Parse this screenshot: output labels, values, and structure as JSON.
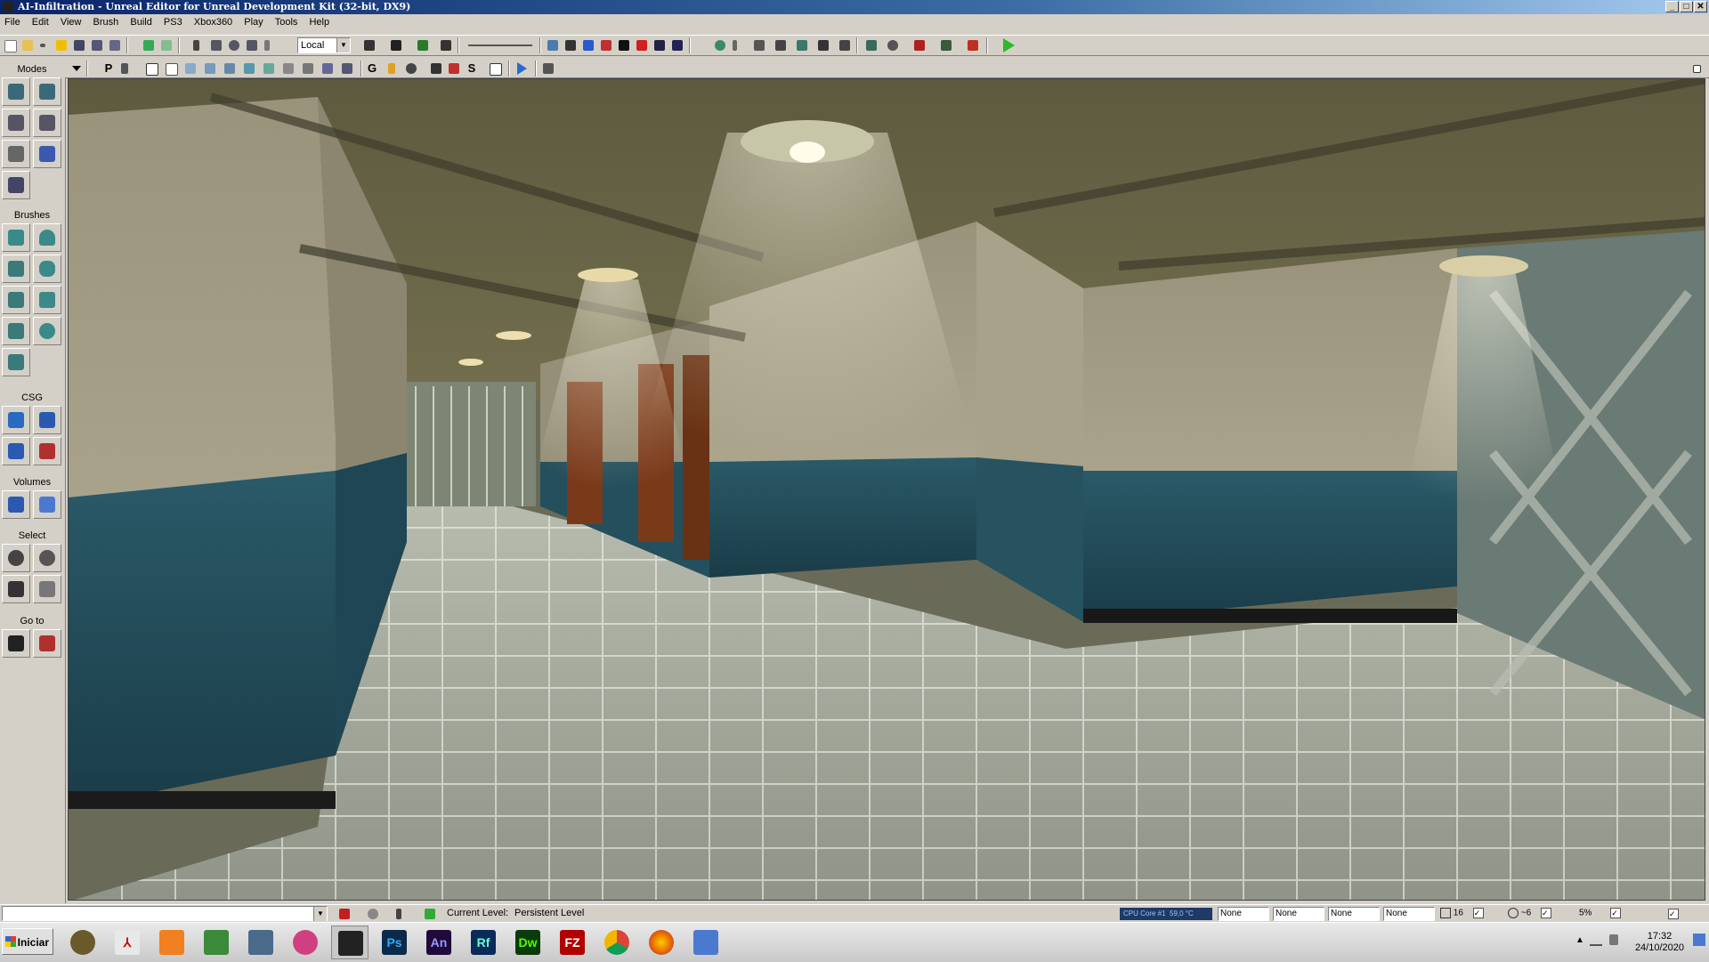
{
  "window": {
    "title": "AI-Infiltration - Unreal Editor for Unreal Development Kit (32-bit, DX9)",
    "controls": {
      "minimize": "_",
      "maximize": "□",
      "close": "✕"
    }
  },
  "menu": [
    "File",
    "Edit",
    "View",
    "Brush",
    "Build",
    "PS3",
    "Xbox360",
    "Play",
    "Tools",
    "Help"
  ],
  "toolbar": {
    "coord_system": "Local"
  },
  "left_panel": {
    "sections": {
      "modes": "Modes",
      "brushes": "Brushes",
      "csg": "CSG",
      "volumes": "Volumes",
      "select": "Select",
      "goto": "Go to"
    }
  },
  "viewport_toolbar": {
    "letters": {
      "p": "P",
      "g": "G",
      "s": "S"
    }
  },
  "status": {
    "current_level_label": "Current Level:",
    "current_level_value": "Persistent Level",
    "cpu_label": "CPU Core #1",
    "cpu_temp": "59,0 °C",
    "fields": [
      "None",
      "None",
      "None",
      "None"
    ],
    "grid_snap": "16",
    "rotation_snap": "~6",
    "scale_snap": "5%"
  },
  "taskbar": {
    "start_label": "Iniciar",
    "apps": [
      {
        "name": "ps",
        "label": "Ps",
        "color": "#0b2a4a",
        "fg": "#31a8ff"
      },
      {
        "name": "an",
        "label": "An",
        "color": "#1f0a3a",
        "fg": "#9999ff"
      },
      {
        "name": "rf",
        "label": "Rf",
        "color": "#0a2a5a",
        "fg": "#6fc"
      },
      {
        "name": "dw",
        "label": "Dw",
        "color": "#0b3a0b",
        "fg": "#4cff00"
      },
      {
        "name": "fz",
        "label": "FZ",
        "color": "#b00000",
        "fg": "#fff"
      }
    ],
    "clock_time": "17:32",
    "clock_date": "24/10/2020"
  },
  "colors": {
    "title_bar": "#0a246a",
    "chrome": "#d4d0c8",
    "wall_blue": "#1f4c5c",
    "wall_plaster": "#a9a18a",
    "floor_tile": "#a4a89a"
  }
}
